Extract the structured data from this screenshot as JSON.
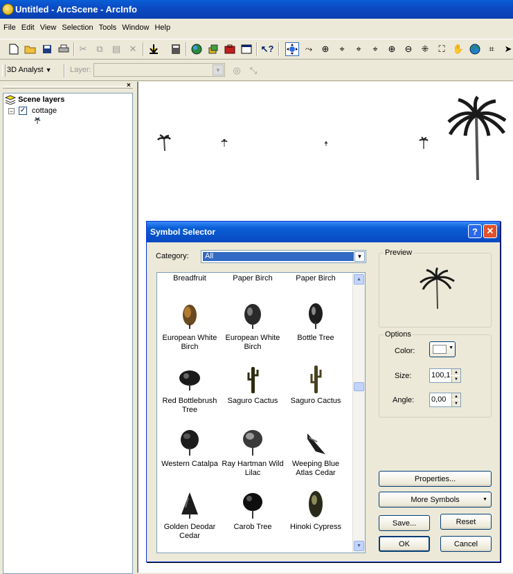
{
  "window": {
    "title": "Untitled - ArcScene - ArcInfo"
  },
  "menu": [
    "File",
    "Edit",
    "View",
    "Selection",
    "Tools",
    "Window",
    "Help"
  ],
  "toolbar2": {
    "analyst_label": "3D Analyst",
    "layer_label": "Layer:",
    "layer_value": ""
  },
  "toc": {
    "root_label": "Scene layers",
    "layer_name": "cottage"
  },
  "dialog": {
    "title": "Symbol Selector",
    "help_glyph": "?",
    "close_glyph": "✕",
    "category_label": "Category:",
    "category_value": "All",
    "preview_label": "Preview",
    "options_label": "Options",
    "color_label": "Color:",
    "size_label": "Size:",
    "size_value": "100,1",
    "angle_label": "Angle:",
    "angle_value": "0,00",
    "properties_label": "Properties...",
    "more_symbols_label": "More Symbols",
    "save_label": "Save...",
    "reset_label": "Reset",
    "ok_label": "OK",
    "cancel_label": "Cancel",
    "symbols": [
      "Breadfruit",
      "Paper Birch",
      "Paper Birch",
      "European White Birch",
      "European White Birch",
      "Bottle Tree",
      "Red Bottlebrush Tree",
      "Saguro Cactus",
      "Saguro Cactus",
      "Western Catalpa",
      "Ray Hartman Wild Lilac",
      "Weeping Blue Atlas Cedar",
      "Golden Deodar Cedar",
      "Carob Tree",
      "Hinoki Cypress"
    ]
  },
  "colors": {
    "title_blue": "#0a5fd6",
    "category_highlight": "#316ac5",
    "dialog_bg": "#ece9d8"
  }
}
